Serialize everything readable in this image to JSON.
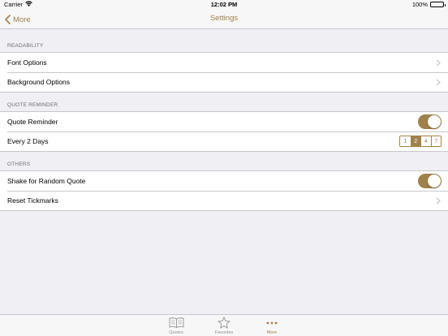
{
  "status_bar": {
    "carrier": "Carrier",
    "time": "12:02 PM",
    "battery": "100%"
  },
  "nav": {
    "back_label": "More",
    "title": "Settings"
  },
  "sections": [
    {
      "header": "READABILITY",
      "rows": [
        {
          "label": "Font Options",
          "accessory": "chevron"
        },
        {
          "label": "Background Options",
          "accessory": "chevron"
        }
      ]
    },
    {
      "header": "QUOTE REMINDER",
      "rows": [
        {
          "label": "Quote Reminder",
          "accessory": "toggle",
          "on": true
        },
        {
          "label": "Every 2 Days",
          "accessory": "segmented",
          "options": [
            "1",
            "2",
            "4",
            "7"
          ],
          "selected": "2"
        }
      ]
    },
    {
      "header": "OTHERS",
      "rows": [
        {
          "label": "Shake for Random Quote",
          "accessory": "toggle",
          "on": true
        },
        {
          "label": "Reset Tickmarks",
          "accessory": "chevron"
        }
      ]
    }
  ],
  "tab_bar": {
    "tabs": [
      {
        "label": "Quotes",
        "icon": "book-icon",
        "active": false
      },
      {
        "label": "Favorites",
        "icon": "star-icon",
        "active": false
      },
      {
        "label": "More",
        "icon": "more-icon",
        "active": true
      }
    ]
  },
  "colors": {
    "accent": "#a0814a",
    "background": "#efeff4",
    "separator": "#c8c7cc",
    "inactive_tab": "#929292"
  }
}
